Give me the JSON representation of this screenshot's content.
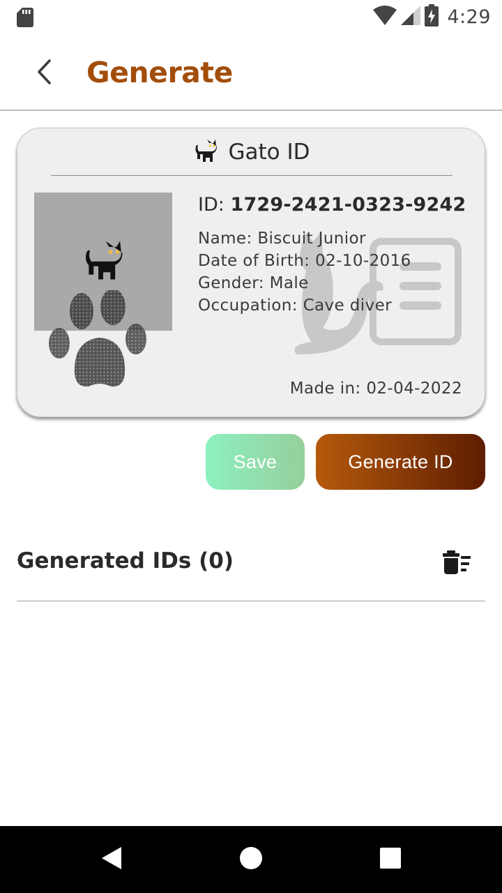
{
  "status_bar": {
    "time": "4:29",
    "icons": [
      "sd-card-icon",
      "wifi-icon",
      "cell-signal-icon",
      "battery-charging-icon"
    ]
  },
  "app_bar": {
    "title": "Generate",
    "back_icon": "chevron-left-icon",
    "title_color": "#a24d0a"
  },
  "card": {
    "title": "Gato ID",
    "title_icon": "cat-icon",
    "id_label": "ID:",
    "id_value": "1729-2421-0323-9242",
    "name": "Name: Biscuit Junior",
    "dob": "Date of Birth: 02-10-2016",
    "gender": "Gender: Male",
    "occupation": "Occupation: Cave diver",
    "made_in": "Made in: 02-04-2022",
    "photo_icon": "cat-icon",
    "pawprint_icon": "paw-print-icon",
    "watermark_icon": "cat-id-card-icon"
  },
  "actions": {
    "save_label": "Save",
    "generate_label": "Generate ID",
    "save_colors": [
      "#8ef0c0",
      "#95cf9c"
    ],
    "generate_colors": [
      "#b55a0c",
      "#5e1d00"
    ]
  },
  "generated": {
    "title": "Generated IDs (0)",
    "delete_icon": "delete-sweep-icon"
  },
  "nav": {
    "icons": [
      "back-triangle-icon",
      "home-circle-icon",
      "recents-square-icon"
    ]
  }
}
